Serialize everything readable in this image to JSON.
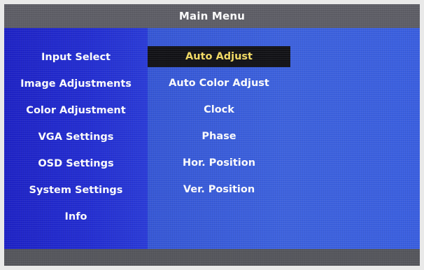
{
  "osd": {
    "title": "Main Menu",
    "colors": {
      "title_bar": "#5e5e66",
      "left_panel": "#2229cc",
      "right_panel": "#3b5bd9",
      "selected_bg": "#121216",
      "selected_text": "#f4dc64",
      "text": "#ffffff"
    },
    "menu_items": [
      {
        "label": "Input Select"
      },
      {
        "label": "Image Adjustments"
      },
      {
        "label": "Color Adjustment"
      },
      {
        "label": "VGA Settings"
      },
      {
        "label": "OSD Settings"
      },
      {
        "label": "System Settings"
      },
      {
        "label": "Info"
      }
    ],
    "submenu_items": [
      {
        "label": "Auto Adjust",
        "selected": true
      },
      {
        "label": "Auto Color Adjust",
        "selected": false
      },
      {
        "label": "Clock",
        "selected": false
      },
      {
        "label": "Phase",
        "selected": false
      },
      {
        "label": "Hor. Position",
        "selected": false
      },
      {
        "label": "Ver. Position",
        "selected": false
      }
    ]
  }
}
